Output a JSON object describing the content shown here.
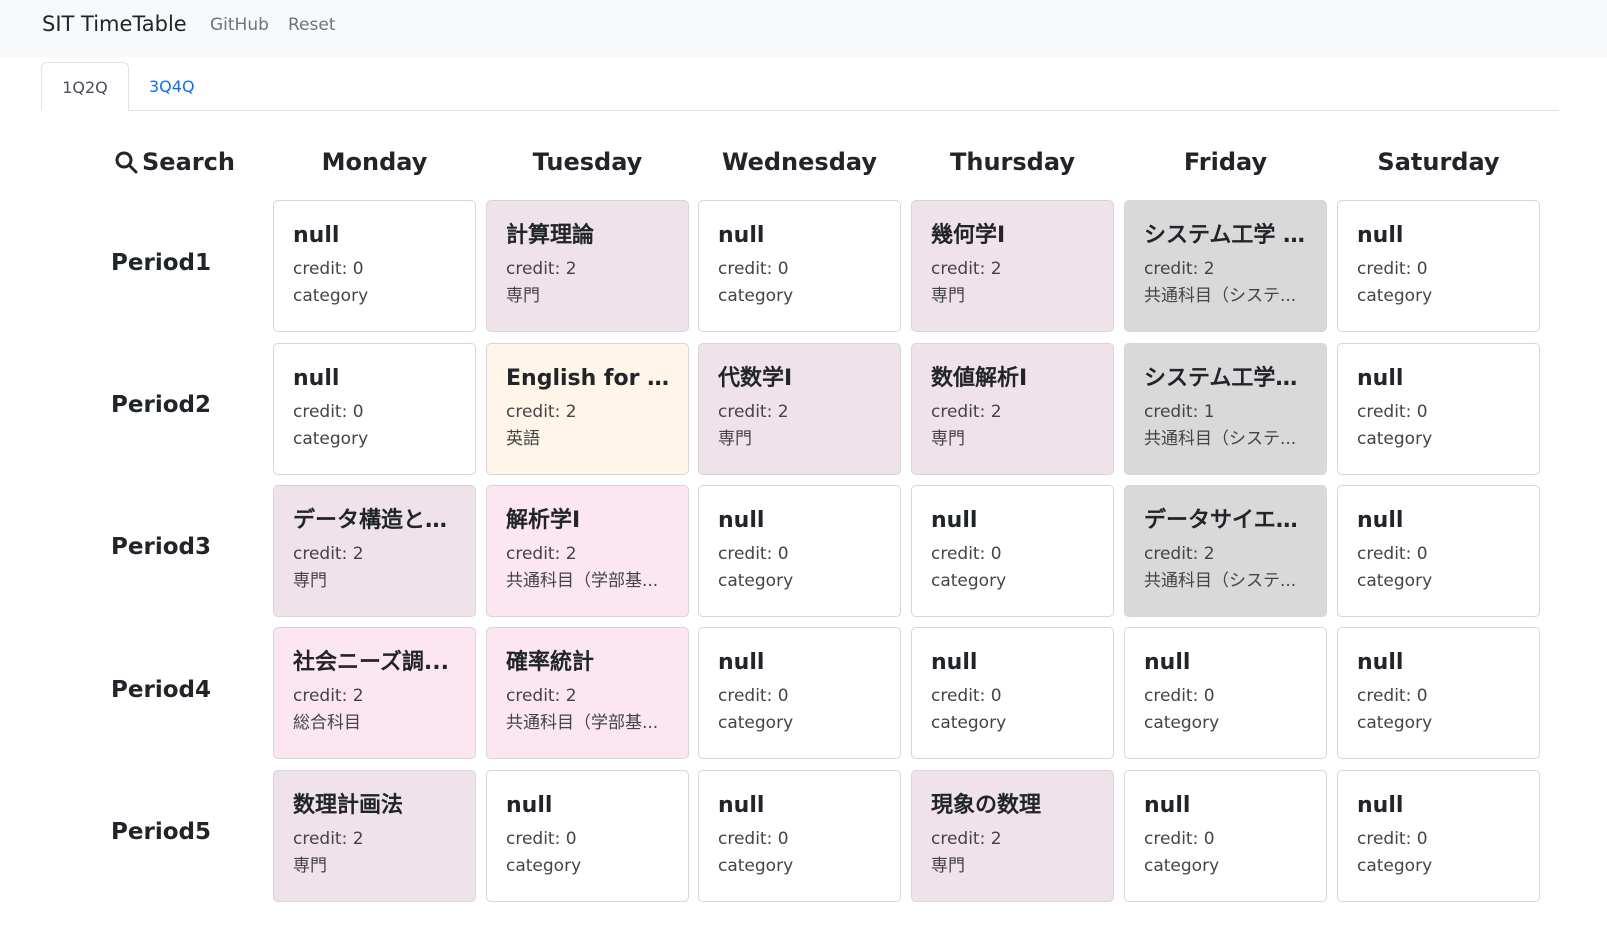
{
  "navbar": {
    "brand": "SIT TimeTable",
    "links": [
      "GitHub",
      "Reset"
    ]
  },
  "tabs": [
    {
      "label": "1Q2Q",
      "active": true
    },
    {
      "label": "3Q4Q",
      "active": false
    }
  ],
  "search_label": "Search",
  "days": [
    "Monday",
    "Tuesday",
    "Wednesday",
    "Thursday",
    "Friday",
    "Saturday"
  ],
  "periods": [
    "Period1",
    "Period2",
    "Period3",
    "Period4",
    "Period5"
  ],
  "colors": {
    "empty": "#ffffff",
    "specialized": "#f0e2eb",
    "english": "#fff5e8",
    "common_faculty": "#fbe6f1",
    "system": "#d9d9d9",
    "general": "#fbe6f1"
  },
  "grid": [
    [
      {
        "name": "null",
        "credit": "credit: 0",
        "category": "category",
        "color": "empty"
      },
      {
        "name": "計算理論",
        "credit": "credit: 2",
        "category": "専門",
        "color": "specialized"
      },
      {
        "name": "null",
        "credit": "credit: 0",
        "category": "category",
        "color": "empty"
      },
      {
        "name": "幾何学I",
        "credit": "credit: 2",
        "category": "専門",
        "color": "specialized"
      },
      {
        "name": "システム工学 A...",
        "credit": "credit: 2",
        "category": "共通科目（システ...",
        "color": "system"
      },
      {
        "name": "null",
        "credit": "credit: 0",
        "category": "category",
        "color": "empty"
      }
    ],
    [
      {
        "name": "null",
        "credit": "credit: 0",
        "category": "category",
        "color": "empty"
      },
      {
        "name": "English for Sc...",
        "credit": "credit: 2",
        "category": "英語",
        "color": "english"
      },
      {
        "name": "代数学I",
        "credit": "credit: 2",
        "category": "専門",
        "color": "specialized"
      },
      {
        "name": "数値解析I",
        "credit": "credit: 2",
        "category": "専門",
        "color": "specialized"
      },
      {
        "name": "システム工学演...",
        "credit": "credit: 1",
        "category": "共通科目（システ...",
        "color": "system"
      },
      {
        "name": "null",
        "credit": "credit: 0",
        "category": "category",
        "color": "empty"
      }
    ],
    [
      {
        "name": "データ構造とア...",
        "credit": "credit: 2",
        "category": "専門",
        "color": "specialized"
      },
      {
        "name": "解析学I",
        "credit": "credit: 2",
        "category": "共通科目（学部基...",
        "color": "common_faculty"
      },
      {
        "name": "null",
        "credit": "credit: 0",
        "category": "category",
        "color": "empty"
      },
      {
        "name": "null",
        "credit": "credit: 0",
        "category": "category",
        "color": "empty"
      },
      {
        "name": "データサイエンス...",
        "credit": "credit: 2",
        "category": "共通科目（システ...",
        "color": "system"
      },
      {
        "name": "null",
        "credit": "credit: 0",
        "category": "category",
        "color": "empty"
      }
    ],
    [
      {
        "name": "社会ニーズ調...",
        "credit": "credit: 2",
        "category": "総合科目",
        "color": "general"
      },
      {
        "name": "確率統計",
        "credit": "credit: 2",
        "category": "共通科目（学部基...",
        "color": "common_faculty"
      },
      {
        "name": "null",
        "credit": "credit: 0",
        "category": "category",
        "color": "empty"
      },
      {
        "name": "null",
        "credit": "credit: 0",
        "category": "category",
        "color": "empty"
      },
      {
        "name": "null",
        "credit": "credit: 0",
        "category": "category",
        "color": "empty"
      },
      {
        "name": "null",
        "credit": "credit: 0",
        "category": "category",
        "color": "empty"
      }
    ],
    [
      {
        "name": "数理計画法",
        "credit": "credit: 2",
        "category": "専門",
        "color": "specialized"
      },
      {
        "name": "null",
        "credit": "credit: 0",
        "category": "category",
        "color": "empty"
      },
      {
        "name": "null",
        "credit": "credit: 0",
        "category": "category",
        "color": "empty"
      },
      {
        "name": "現象の数理",
        "credit": "credit: 2",
        "category": "専門",
        "color": "specialized"
      },
      {
        "name": "null",
        "credit": "credit: 0",
        "category": "category",
        "color": "empty"
      },
      {
        "name": "null",
        "credit": "credit: 0",
        "category": "category",
        "color": "empty"
      }
    ]
  ]
}
